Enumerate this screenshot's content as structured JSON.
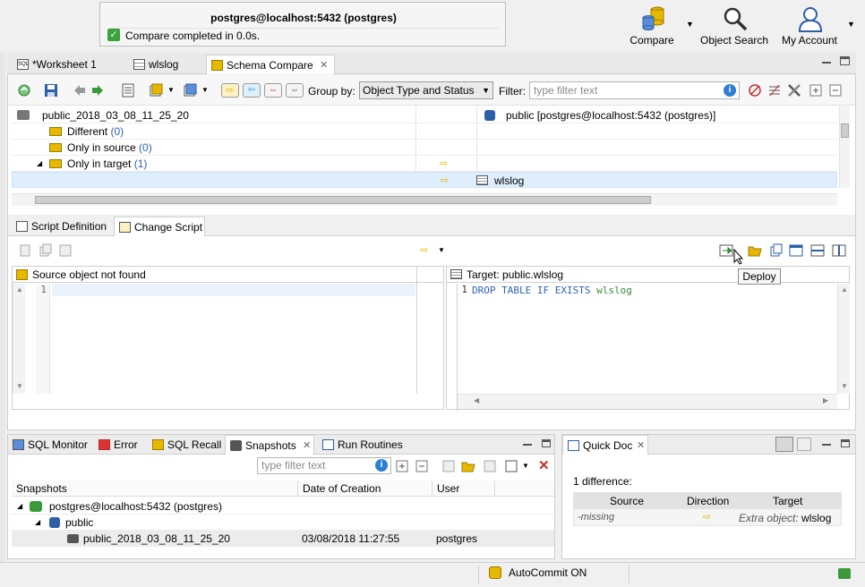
{
  "notification": {
    "title": "postgres@localhost:5432 (postgres)",
    "message": "Compare completed in 0.0s."
  },
  "main_toolbar": {
    "compare": "Compare",
    "object_search": "Object Search",
    "my_account": "My Account"
  },
  "editor_tabs": [
    {
      "label": "*Worksheet 1"
    },
    {
      "label": "wlslog"
    },
    {
      "label": "Schema Compare",
      "active": true
    }
  ],
  "compare_toolbar": {
    "group_by_label": "Group by:",
    "group_by_value": "Object Type and Status",
    "filter_label": "Filter:",
    "filter_placeholder": "type filter text"
  },
  "tree": {
    "source_root": "public_2018_03_08_11_25_20",
    "target_root": "public [postgres@localhost:5432 (postgres)]",
    "different_label": "Different",
    "different_count": "(0)",
    "only_source_label": "Only in source",
    "only_source_count": "(0)",
    "only_target_label": "Only in target",
    "only_target_count": "(1)",
    "selected_target": "wlslog"
  },
  "script_tabs": [
    "Script Definition",
    "Change Script"
  ],
  "tooltip": "Deploy",
  "source_pane": {
    "header": "Source object not found",
    "line": "1"
  },
  "target_pane": {
    "header": "Target: public.wlslog",
    "line": "1",
    "code_kw": "DROP TABLE IF EXISTS",
    "code_id": "wlslog"
  },
  "bottom_tabs": [
    "SQL Monitor",
    "Error",
    "SQL Recall",
    "Snapshots",
    "Run Routines"
  ],
  "snapshots": {
    "filter_placeholder": "type filter text",
    "columns": [
      "Snapshots",
      "Date of Creation",
      "User"
    ],
    "server": "postgres@localhost:5432 (postgres)",
    "schema": "public",
    "snapshot_name": "public_2018_03_08_11_25_20",
    "snapshot_date": "03/08/2018 11:27:55",
    "snapshot_user": "postgres"
  },
  "quick_doc": {
    "tab": "Quick Doc",
    "summary": "1 difference:",
    "columns": [
      "Source",
      "Direction",
      "Target"
    ],
    "source": "-missing",
    "target_prefix": "Extra object:",
    "target_name": "wlslog"
  },
  "statusbar": {
    "autocommit": "AutoCommit ON"
  },
  "colors": {
    "accent": "#2d62b5",
    "arrow": "#e6b800",
    "selection": "#dfeefc"
  }
}
